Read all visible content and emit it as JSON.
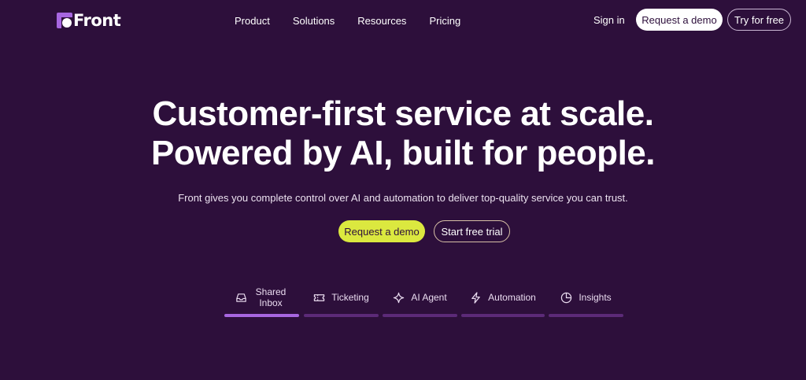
{
  "brand": {
    "name": "Front",
    "logo_icon": "front-logo-icon",
    "accent": "#a766e0"
  },
  "nav": {
    "items": [
      {
        "label": "Product"
      },
      {
        "label": "Solutions"
      },
      {
        "label": "Resources"
      },
      {
        "label": "Pricing"
      }
    ],
    "signin_label": "Sign in",
    "demo_label": "Request a demo",
    "try_label": "Try for free"
  },
  "hero": {
    "title_line1": "Customer-first service at scale.",
    "title_line2": "Powered by AI, built for people.",
    "subtitle": "Front gives you complete control over AI and automation to deliver top-quality service you can trust.",
    "primary_cta": "Request a demo",
    "secondary_cta": "Start free trial",
    "primary_color": "#dbe83f",
    "background": "#2d0f3b"
  },
  "tabs": [
    {
      "label": "Shared Inbox",
      "icon": "inbox-icon",
      "active": true
    },
    {
      "label": "Ticketing",
      "icon": "ticket-icon",
      "active": false
    },
    {
      "label": "AI Agent",
      "icon": "sparkle-icon",
      "active": false
    },
    {
      "label": "Automation",
      "icon": "lightning-icon",
      "active": false
    },
    {
      "label": "Insights",
      "icon": "pie-chart-icon",
      "active": false
    }
  ]
}
